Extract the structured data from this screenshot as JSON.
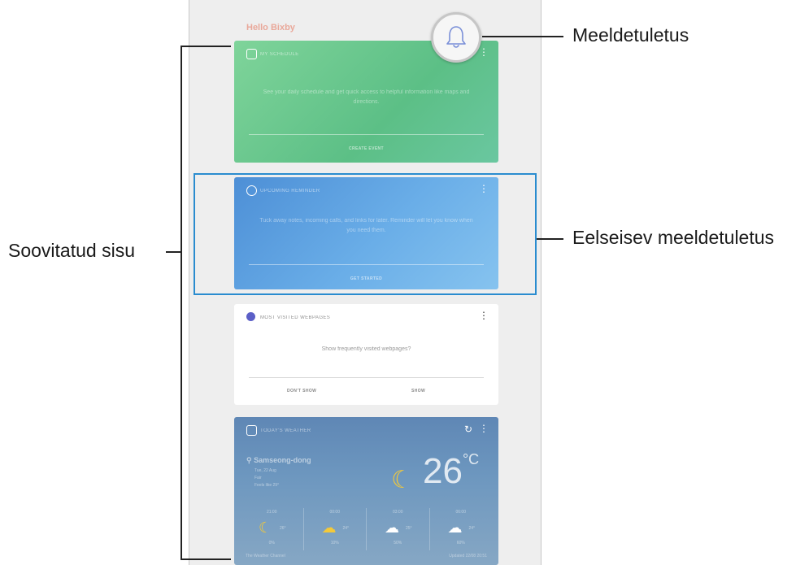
{
  "callouts": {
    "reminder": "Meeldetuletus",
    "upcoming": "Eelseisev meeldetuletus",
    "suggested": "Soovitatud sisu"
  },
  "screen": {
    "title": "Hello Bixby",
    "schedule_card": {
      "header": "MY SCHEDULE",
      "text": "See your daily schedule and get quick access to helpful information like maps and directions.",
      "action": "CREATE EVENT"
    },
    "reminder_card": {
      "header": "UPCOMING REMINDER",
      "text": "Tuck away notes, incoming calls, and links for later. Reminder will let you know when you need them.",
      "action": "GET STARTED"
    },
    "web_card": {
      "header": "MOST VISITED WEBPAGES",
      "text": "Show frequently visited webpages?",
      "action_left": "DON'T SHOW",
      "action_right": "SHOW"
    },
    "weather_card": {
      "header": "TODAY'S WEATHER",
      "location": "Samseong-dong",
      "date": "Tue, 22 Aug",
      "condition": "Fair",
      "feels": "Feels like 29°",
      "temperature": "26",
      "unit": "°C",
      "hours": [
        {
          "time": "21:00",
          "deg": "26°",
          "precip": "0%",
          "icon": "moon-icon"
        },
        {
          "time": "00:00",
          "deg": "24°",
          "precip": "10%",
          "icon": "moon-cloud-icon"
        },
        {
          "time": "03:00",
          "deg": "25°",
          "precip": "50%",
          "icon": "rain-icon"
        },
        {
          "time": "06:00",
          "deg": "24°",
          "precip": "60%",
          "icon": "rain-icon"
        }
      ],
      "source": "The Weather Channel",
      "updated": "Updated 22/08 20:51"
    }
  },
  "colors": {
    "highlight": "#2a8ccf",
    "schedule": "#5cbf86",
    "reminder": "#4d8fd6",
    "weather": "#6d97bf"
  }
}
